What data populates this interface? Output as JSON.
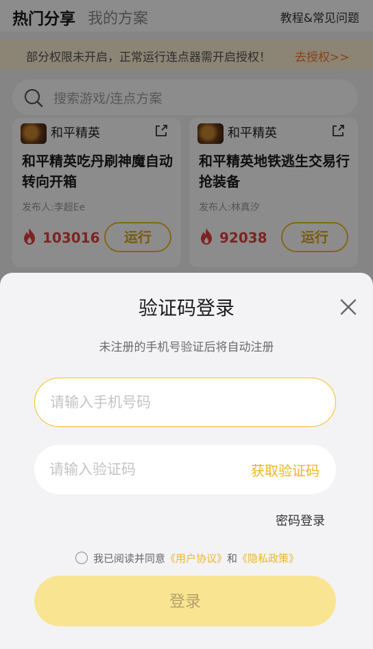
{
  "header": {
    "tab_hot": "热门分享",
    "tab_mine": "我的方案",
    "help": "教程&常见问题"
  },
  "notice": {
    "text": "部分权限未开启，正常运行连点器需开启授权！",
    "link": "去授权>>"
  },
  "search": {
    "placeholder": "搜索游戏/连点方案"
  },
  "cards": [
    {
      "game": "和平精英",
      "title": "和平精英吃丹刷神魔自动转向开箱",
      "author": "发布人:李超Ee",
      "heat": "103016",
      "run_label": "运行"
    },
    {
      "game": "和平精英",
      "title": "和平精英地铁逃生交易行抢装备",
      "author": "发布人:林真汐",
      "heat": "92038",
      "run_label": "运行"
    }
  ],
  "login_sheet": {
    "title": "验证码登录",
    "subtitle": "未注册的手机号验证后将自动注册",
    "phone_placeholder": "请输入手机号码",
    "code_placeholder": "请输入验证码",
    "get_code": "获取验证码",
    "password_login": "密码登录",
    "agree_prefix": "我已阅读并同意",
    "user_agreement": "《用户协议》",
    "agree_and": "和",
    "privacy_policy": "《隐私政策》",
    "login_button": "登录"
  },
  "colors": {
    "accent": "#f2b824",
    "heat": "#e0423f",
    "notice_link": "#f07a2b",
    "login_button_bg": "#f9e591"
  },
  "icons": {
    "search": "search-icon",
    "share": "share-icon",
    "fire": "fire-icon",
    "close": "close-icon"
  }
}
